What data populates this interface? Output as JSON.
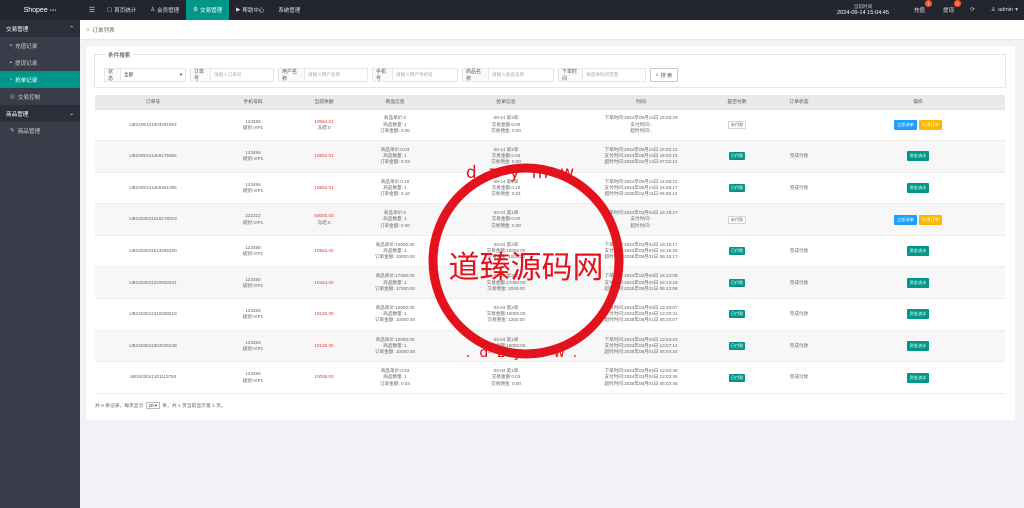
{
  "brand": {
    "name": "Shopee",
    "sup": "1.6.1"
  },
  "topnav": [
    {
      "label": "首页统计",
      "icon": "home-icon"
    },
    {
      "label": "会员管理",
      "icon": "user-icon"
    },
    {
      "label": "交易管理",
      "icon": "swap-icon"
    },
    {
      "label": "帮助中心",
      "icon": "help-icon"
    },
    {
      "label": "系统管理",
      "icon": "settings-icon"
    }
  ],
  "top_time": {
    "label": "当前时间",
    "value": "2024-09-14 15:04:45"
  },
  "top_right": {
    "recharge": "充值",
    "recharge_count": "1",
    "withdraw": "提现",
    "withdraw_count": "0",
    "user": "admin"
  },
  "sidebar": {
    "group1": "交易管理",
    "items1": [
      "充值记录",
      "提现记录",
      "抢单记录",
      "交易控制"
    ],
    "group2": "商品管理",
    "items2": [
      "商品管理"
    ]
  },
  "breadcrumb": "订单列表",
  "filter": {
    "legend": "条件搜索",
    "status_label": "状态",
    "status_value": "全部",
    "order_label": "订单号",
    "order_placeholder": "请输入订单号",
    "user_label": "用户名称",
    "user_placeholder": "请输入用户名称",
    "phone_label": "手机号",
    "phone_placeholder": "请输入用户手机号",
    "goods_label": "商品名称",
    "goods_placeholder": "请输入商品名称",
    "time_label": "下单时间",
    "time_placeholder": "请选择时间范围",
    "search_label": "搜 索"
  },
  "table": {
    "headers": [
      "订单号",
      "手机号码",
      "当前余额",
      "商品信息",
      "抢单信息",
      "时间",
      "是否付款",
      "订单状态",
      "操作"
    ],
    "rows": [
      {
        "id": "UB2409141503291604",
        "phone": "123456",
        "level": "级别:VIP1",
        "balance": "10564.01",
        "frozen": "冻结:0",
        "goods": [
          "商品单价:0",
          "商品数量: 1",
          "订单金额: 0.00"
        ],
        "grab": [
          "09-14 第3单",
          "交易金额:0.00",
          "交易佣金: 0.00"
        ],
        "time": [
          "下单时间:2024年09月14日 15:03:29",
          "支付时间:-",
          "超时时间:-"
        ],
        "paid": "未付款",
        "status": "",
        "ops": [
          "立即派单",
          "取消订单"
        ]
      },
      {
        "id": "UB2409141459175952",
        "phone": "123456",
        "level": "级别:VIP1",
        "balance": "10564.01",
        "frozen": "",
        "goods": [
          "商品单价:0.03",
          "商品数量: 1",
          "订单金额: 0.03"
        ],
        "grab": [
          "09-14 第2单",
          "交易金额:0.03",
          "交易佣金: 0.00"
        ],
        "time": [
          "下单时间:2024年09月14日 15:02:12",
          "支付时间:2024年09月14日 15:02:16",
          "超时时间:2036年02月14日 07:02:12"
        ],
        "paid": "已付款",
        "status": "完成付款",
        "ops": [
          "资金流水"
        ]
      },
      {
        "id": "UB2409141456461085",
        "phone": "123456",
        "level": "级别:VIP1",
        "balance": "10564.01",
        "frozen": "",
        "goods": [
          "商品单价:0.10",
          "商品数量: 1",
          "订单金额: 0.10"
        ],
        "grab": [
          "09-14 第1单",
          "交易金额:0.10",
          "交易佣金: 0.01"
        ],
        "time": [
          "下单时间:2024年09月14日 14:58:12",
          "支付时间:2024年09月14日 14:58:17",
          "超时时间:2036年02月11日 06:58:12"
        ],
        "paid": "已付款",
        "status": "完成付款",
        "ops": [
          "资金流水"
        ]
      },
      {
        "id": "UB2403041618278019",
        "phone": "222222",
        "level": "级别:VIP1",
        "balance": "50000.00",
        "frozen": "冻结:0",
        "goods": [
          "商品单价:0",
          "商品数量: 1",
          "订单金额: 0.00"
        ],
        "grab": [
          "03-04 第1单",
          "交易金额:0.00",
          "交易佣金: 0.00"
        ],
        "time": [
          "下单时间:2024年03月04日 16:18:27",
          "支付时间:-",
          "超时时间:-"
        ],
        "paid": "未付款",
        "status": "",
        "ops": [
          "立即派单",
          "取消订单"
        ]
      },
      {
        "id": "UB2403041613265490",
        "phone": "123456",
        "level": "级别:VIP1",
        "balance": "10564.00",
        "frozen": "",
        "goods": [
          "商品单价:10000.00",
          "商品数量: 1",
          "订单金额: 10000.00"
        ],
        "grab": [
          "03-04 第3单",
          "交易金额:10000.00",
          "交易佣金: 1000.00"
        ],
        "time": [
          "下单时间:2024年03月04日 16:16:17",
          "支付时间:2024年03月04日 16:16:28",
          "超时时间:2035年08月01日 06:16:17"
        ],
        "paid": "已付款",
        "status": "完成付款",
        "ops": [
          "资金流水"
        ]
      },
      {
        "id": "UB2403041320562541",
        "phone": "123456",
        "level": "级别:VIP1",
        "balance": "10444.00",
        "frozen": "",
        "goods": [
          "商品单价:17000.00",
          "商品数量: 1",
          "订单金额: 17000.00"
        ],
        "grab": [
          "03-04 第2单",
          "交易金额:17000.00",
          "交易佣金: 2040.00"
        ],
        "time": [
          "下单时间:2024年03月04日 16:13:08",
          "支付时间:2024年03月04日 16:13:16",
          "超时时间:2035年08月01日 06:13:08"
        ],
        "paid": "已付款",
        "status": "完成付款",
        "ops": [
          "资金流水"
        ]
      },
      {
        "id": "UB2403041310256619",
        "phone": "123456",
        "level": "级别:VIP1",
        "balance": "10240.00",
        "frozen": "",
        "goods": [
          "商品单价:10000.00",
          "商品数量: 1",
          "订单金额: 10000.00"
        ],
        "grab": [
          "03-04 第2单",
          "交易金额:10000.00",
          "交易佣金: 1200.00"
        ],
        "time": [
          "下单时间:2024年03月04日 13:20:07",
          "支付时间:2024年03月04日 13:20:21",
          "超时时间:2035年08月01日 05:20:07"
        ],
        "paid": "已付款",
        "status": "完成付款",
        "ops": [
          "资金流水"
        ]
      },
      {
        "id": "UB2403041304026249",
        "phone": "123456",
        "level": "级别:VIP1",
        "balance": "10120.00",
        "frozen": "",
        "goods": [
          "商品单价:10000.00",
          "商品数量: 1",
          "订单金额: 10000.00"
        ],
        "grab": [
          "03-04 第1单",
          "交易金额:10000.00",
          "交易佣金: 1200.00"
        ],
        "time": [
          "下单时间:2024年03月04日 13:04:24",
          "支付时间:2024年03月04日 13:07:14",
          "超时时间:2035年08月01日 05:04:24"
        ],
        "paid": "已付款",
        "status": "完成付款",
        "ops": [
          "资金流水"
        ]
      },
      {
        "id": "UB2403041301113763",
        "phone": "123456",
        "level": "级别:VIP1",
        "balance": "10000.00",
        "frozen": "",
        "goods": [
          "商品单价:0.03",
          "商品数量: 1",
          "订单金额: 0.03"
        ],
        "grab": [
          "03-04 第1单",
          "交易金额:0.03",
          "交易佣金: 0.00"
        ],
        "time": [
          "下单时间:2024年03月04日 13:02:48",
          "支付时间:2024年03月04日 13:03:26",
          "超时时间:2035年08月01日 05:02:48"
        ],
        "paid": "已付款",
        "status": "完成付款",
        "ops": [
          "资金流水"
        ]
      }
    ]
  },
  "footer": {
    "prefix": "共 9 条记录，每页显示",
    "page_size": "20",
    "suffix": "条，共 1 页当前显示第 1 页。"
  },
  "watermark": {
    "site_cn": "道臻源码网",
    "site_url": "www.dzymw.com"
  },
  "colors": {
    "accent": "#009688",
    "danger": "#e4393c",
    "watermark": "#e3121c"
  }
}
